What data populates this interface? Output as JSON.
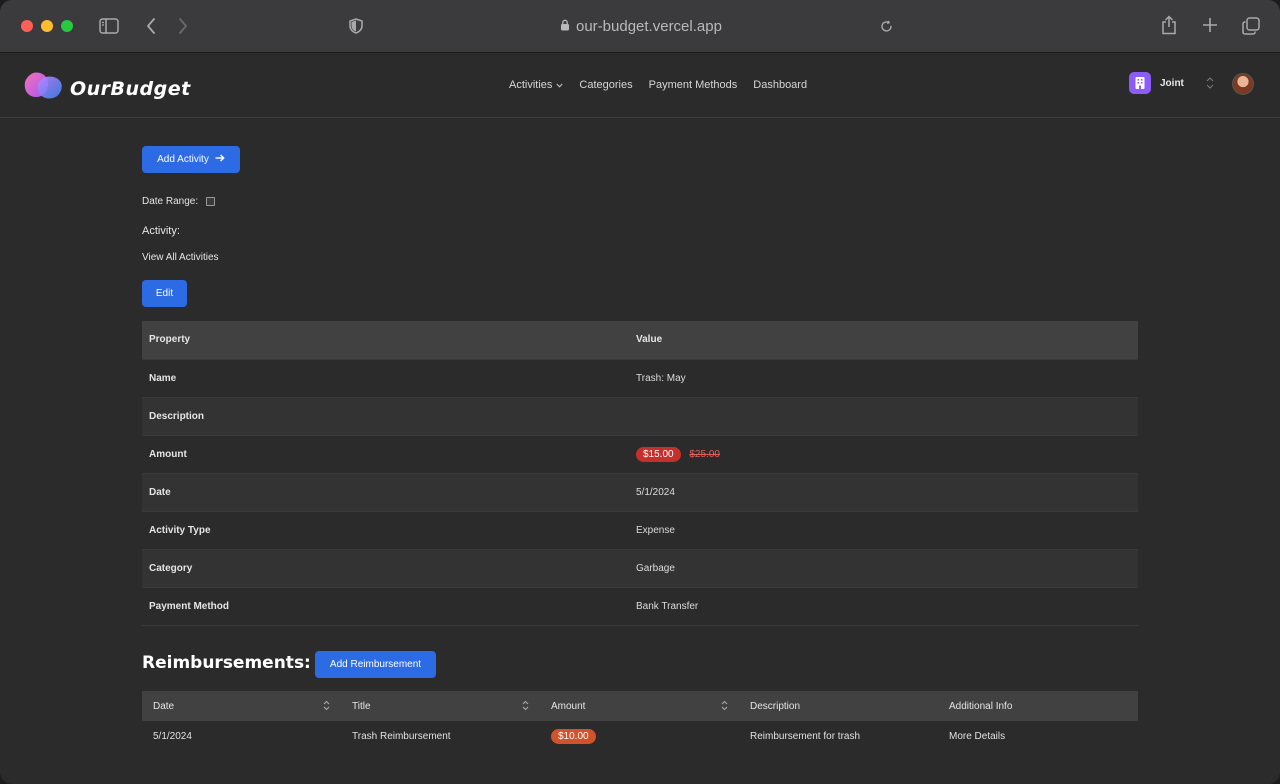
{
  "browser": {
    "url": "our-budget.vercel.app"
  },
  "header": {
    "logo_text": "OurBudget",
    "nav": [
      {
        "label": "Activities",
        "has_dropdown": true
      },
      {
        "label": "Categories"
      },
      {
        "label": "Payment Methods"
      },
      {
        "label": "Dashboard"
      }
    ],
    "account_name": "Joint"
  },
  "actions": {
    "add_activity_label": "Add Activity",
    "date_range_label": "Date Range:",
    "activity_label": "Activity:",
    "view_all_label": "View All Activities",
    "edit_label": "Edit"
  },
  "details": {
    "headers": {
      "property": "Property",
      "value": "Value"
    },
    "rows": [
      {
        "property": "Name",
        "value": "Trash: May"
      },
      {
        "property": "Description",
        "value": ""
      },
      {
        "property": "Amount",
        "value": "$15.00",
        "original_value": "$25.00"
      },
      {
        "property": "Date",
        "value": "5/1/2024"
      },
      {
        "property": "Activity Type",
        "value": "Expense"
      },
      {
        "property": "Category",
        "value": "Garbage"
      },
      {
        "property": "Payment Method",
        "value": "Bank Transfer"
      }
    ]
  },
  "reimbursements": {
    "title": "Reimbursements:",
    "add_label": "Add Reimbursement",
    "columns": [
      "Date",
      "Title",
      "Amount",
      "Description",
      "Additional Info"
    ],
    "rows": [
      {
        "date": "5/1/2024",
        "title": "Trash Reimbursement",
        "amount": "$10.00",
        "description": "Reimbursement for trash",
        "info": "More Details"
      }
    ]
  },
  "colors": {
    "accent": "#2d6be4",
    "badge_red": "#c5302c",
    "badge_orange": "#d2522a",
    "account_icon": "#8b5cf6"
  }
}
